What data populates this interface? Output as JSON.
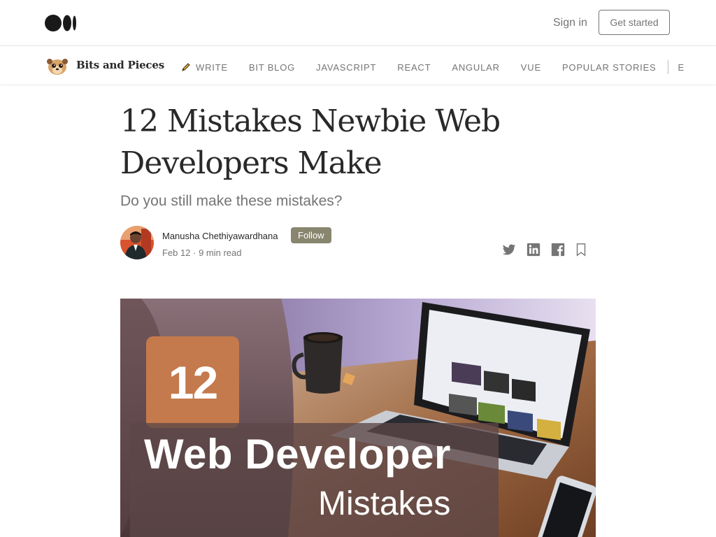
{
  "header": {
    "signin_label": "Sign in",
    "get_started_label": "Get started"
  },
  "publication": {
    "name": "Bits and Pieces",
    "nav": [
      "WRITE",
      "BIT BLOG",
      "JAVASCRIPT",
      "REACT",
      "ANGULAR",
      "VUE",
      "POPULAR STORIES",
      "E"
    ]
  },
  "article": {
    "title": "12 Mistakes Newbie Web Developers Make",
    "subtitle": "Do you still make these mistakes?",
    "author": "Manusha Chethiyawardhana",
    "follow_label": "Follow",
    "date": "Feb 12",
    "separator": "·",
    "read_time": "9 min read"
  },
  "hero": {
    "number": "12",
    "line1": "Web Developer",
    "line2": "Mistakes"
  },
  "colors": {
    "follow_bg": "#89866f",
    "hero_badge": "#c47a4c",
    "text": "#292929",
    "muted": "#757575"
  }
}
